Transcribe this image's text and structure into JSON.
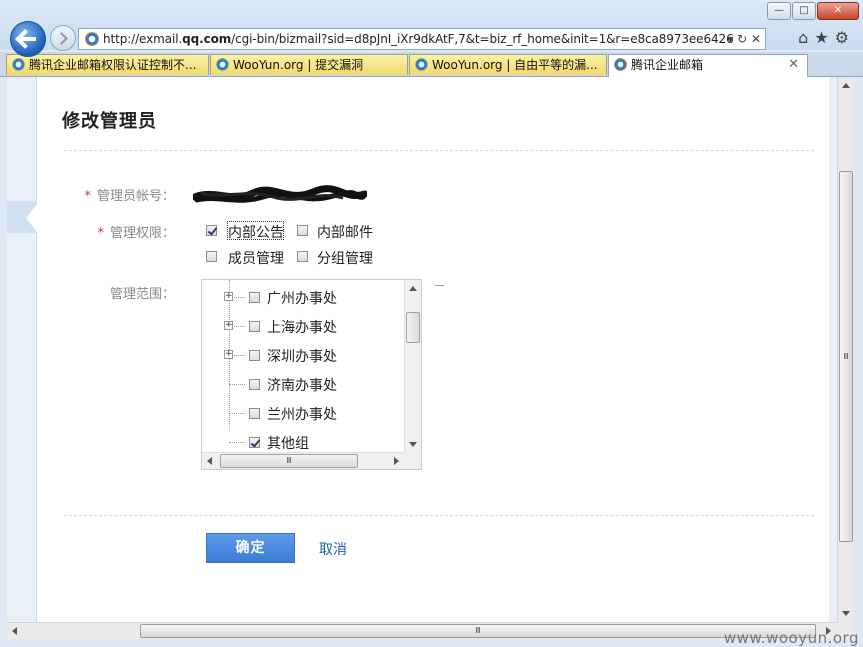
{
  "browser": {
    "address_url_prefix": "http://exmail.",
    "address_url_domain": "qq.com",
    "address_url_suffix": "/cgi-bin/bizmail?sid=d8pJnI_iXr9dkAtF,7&t=biz_rf_home&init=1&r=e8ca8973ee6426",
    "address_controls": "▾ ↻ ✕",
    "window_buttons": {
      "minimize": "—",
      "maximize": "□",
      "close": "✕"
    },
    "toolbar_icons": [
      "home-icon",
      "star-icon",
      "gear-icon"
    ],
    "toolbar_glyphs": "⌂★⚙",
    "tabs": [
      {
        "label": "腾讯企业邮箱权限认证控制不...",
        "icon": "ie-icon",
        "active": false
      },
      {
        "label": "WooYun.org | 提交漏洞",
        "icon": "ie-icon",
        "active": false
      },
      {
        "label": "WooYun.org | 自由平等的漏...",
        "icon": "ie-icon",
        "active": false
      },
      {
        "label": "腾讯企业邮箱",
        "icon": "qq-mail-icon",
        "active": true,
        "close": "✕"
      }
    ]
  },
  "form": {
    "title": "修改管理员",
    "admin_account_label": "管理员帐号：",
    "admin_account_value_redacted": true,
    "permissions_label": "管理权限：",
    "required_mark": "*",
    "permissions": [
      {
        "label": "内部公告",
        "checked": true
      },
      {
        "label": "内部邮件",
        "checked": false
      },
      {
        "label": "成员管理",
        "checked": false
      },
      {
        "label": "分组管理",
        "checked": false
      }
    ],
    "scope_label": "管理范围：",
    "scope_tree": [
      {
        "label": "广州办事处",
        "expandable": true,
        "checked": false
      },
      {
        "label": "上海办事处",
        "expandable": true,
        "checked": false
      },
      {
        "label": "深圳办事处",
        "expandable": true,
        "checked": false
      },
      {
        "label": "济南办事处",
        "expandable": false,
        "checked": false
      },
      {
        "label": "兰州办事处",
        "expandable": false,
        "checked": false
      },
      {
        "label": "其他组",
        "expandable": false,
        "checked": true
      }
    ],
    "scroll_grip": "Ⅲ",
    "confirm_label": "确定",
    "cancel_label": "取消"
  },
  "watermark": "www.wooyun.org",
  "colors": {
    "primary_button": "#3a7bd5",
    "required": "#dd3333",
    "link": "#1d5fa9",
    "tab_inactive": "#f1d86a"
  }
}
